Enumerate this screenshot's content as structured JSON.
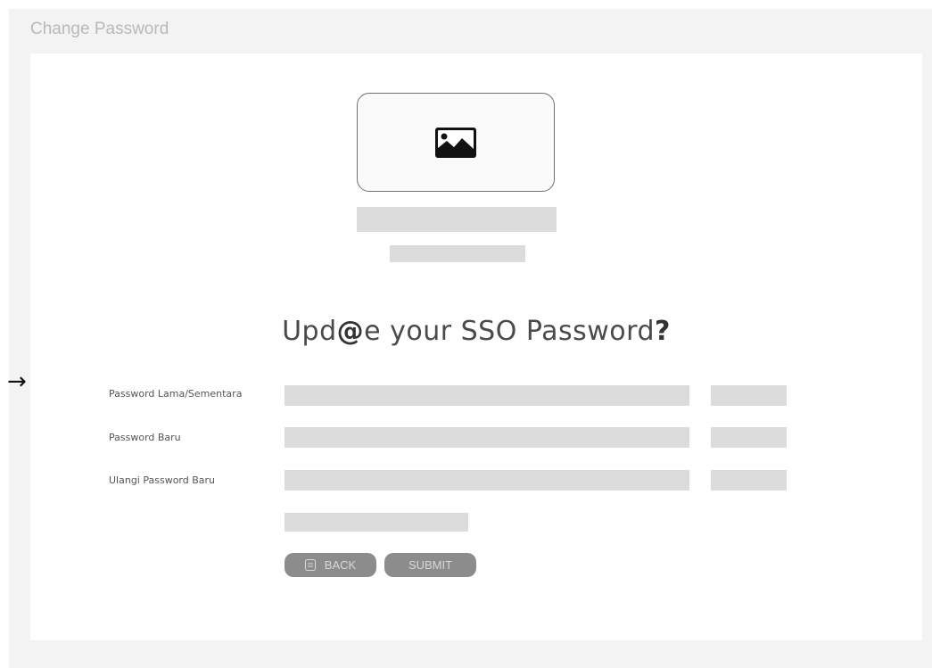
{
  "window": {
    "title": "Change Password"
  },
  "header": {
    "headline_before": "Upd",
    "headline_at": "@",
    "headline_after": "e your SSO Password",
    "headline_q": "?"
  },
  "form": {
    "fields": [
      {
        "label": "Password Lama/Sementara"
      },
      {
        "label": "Password Baru"
      },
      {
        "label": "Ulangi Password Baru"
      }
    ],
    "back_label": "BACK",
    "submit_label": "SUBMIT"
  },
  "icons": {
    "logo": "image-icon",
    "back": "document-icon",
    "pointer": "arrow-right-icon"
  },
  "colors": {
    "frame": "#f3f3f3",
    "placeholder": "#dcdcdc",
    "button": "#8c8c8c"
  }
}
